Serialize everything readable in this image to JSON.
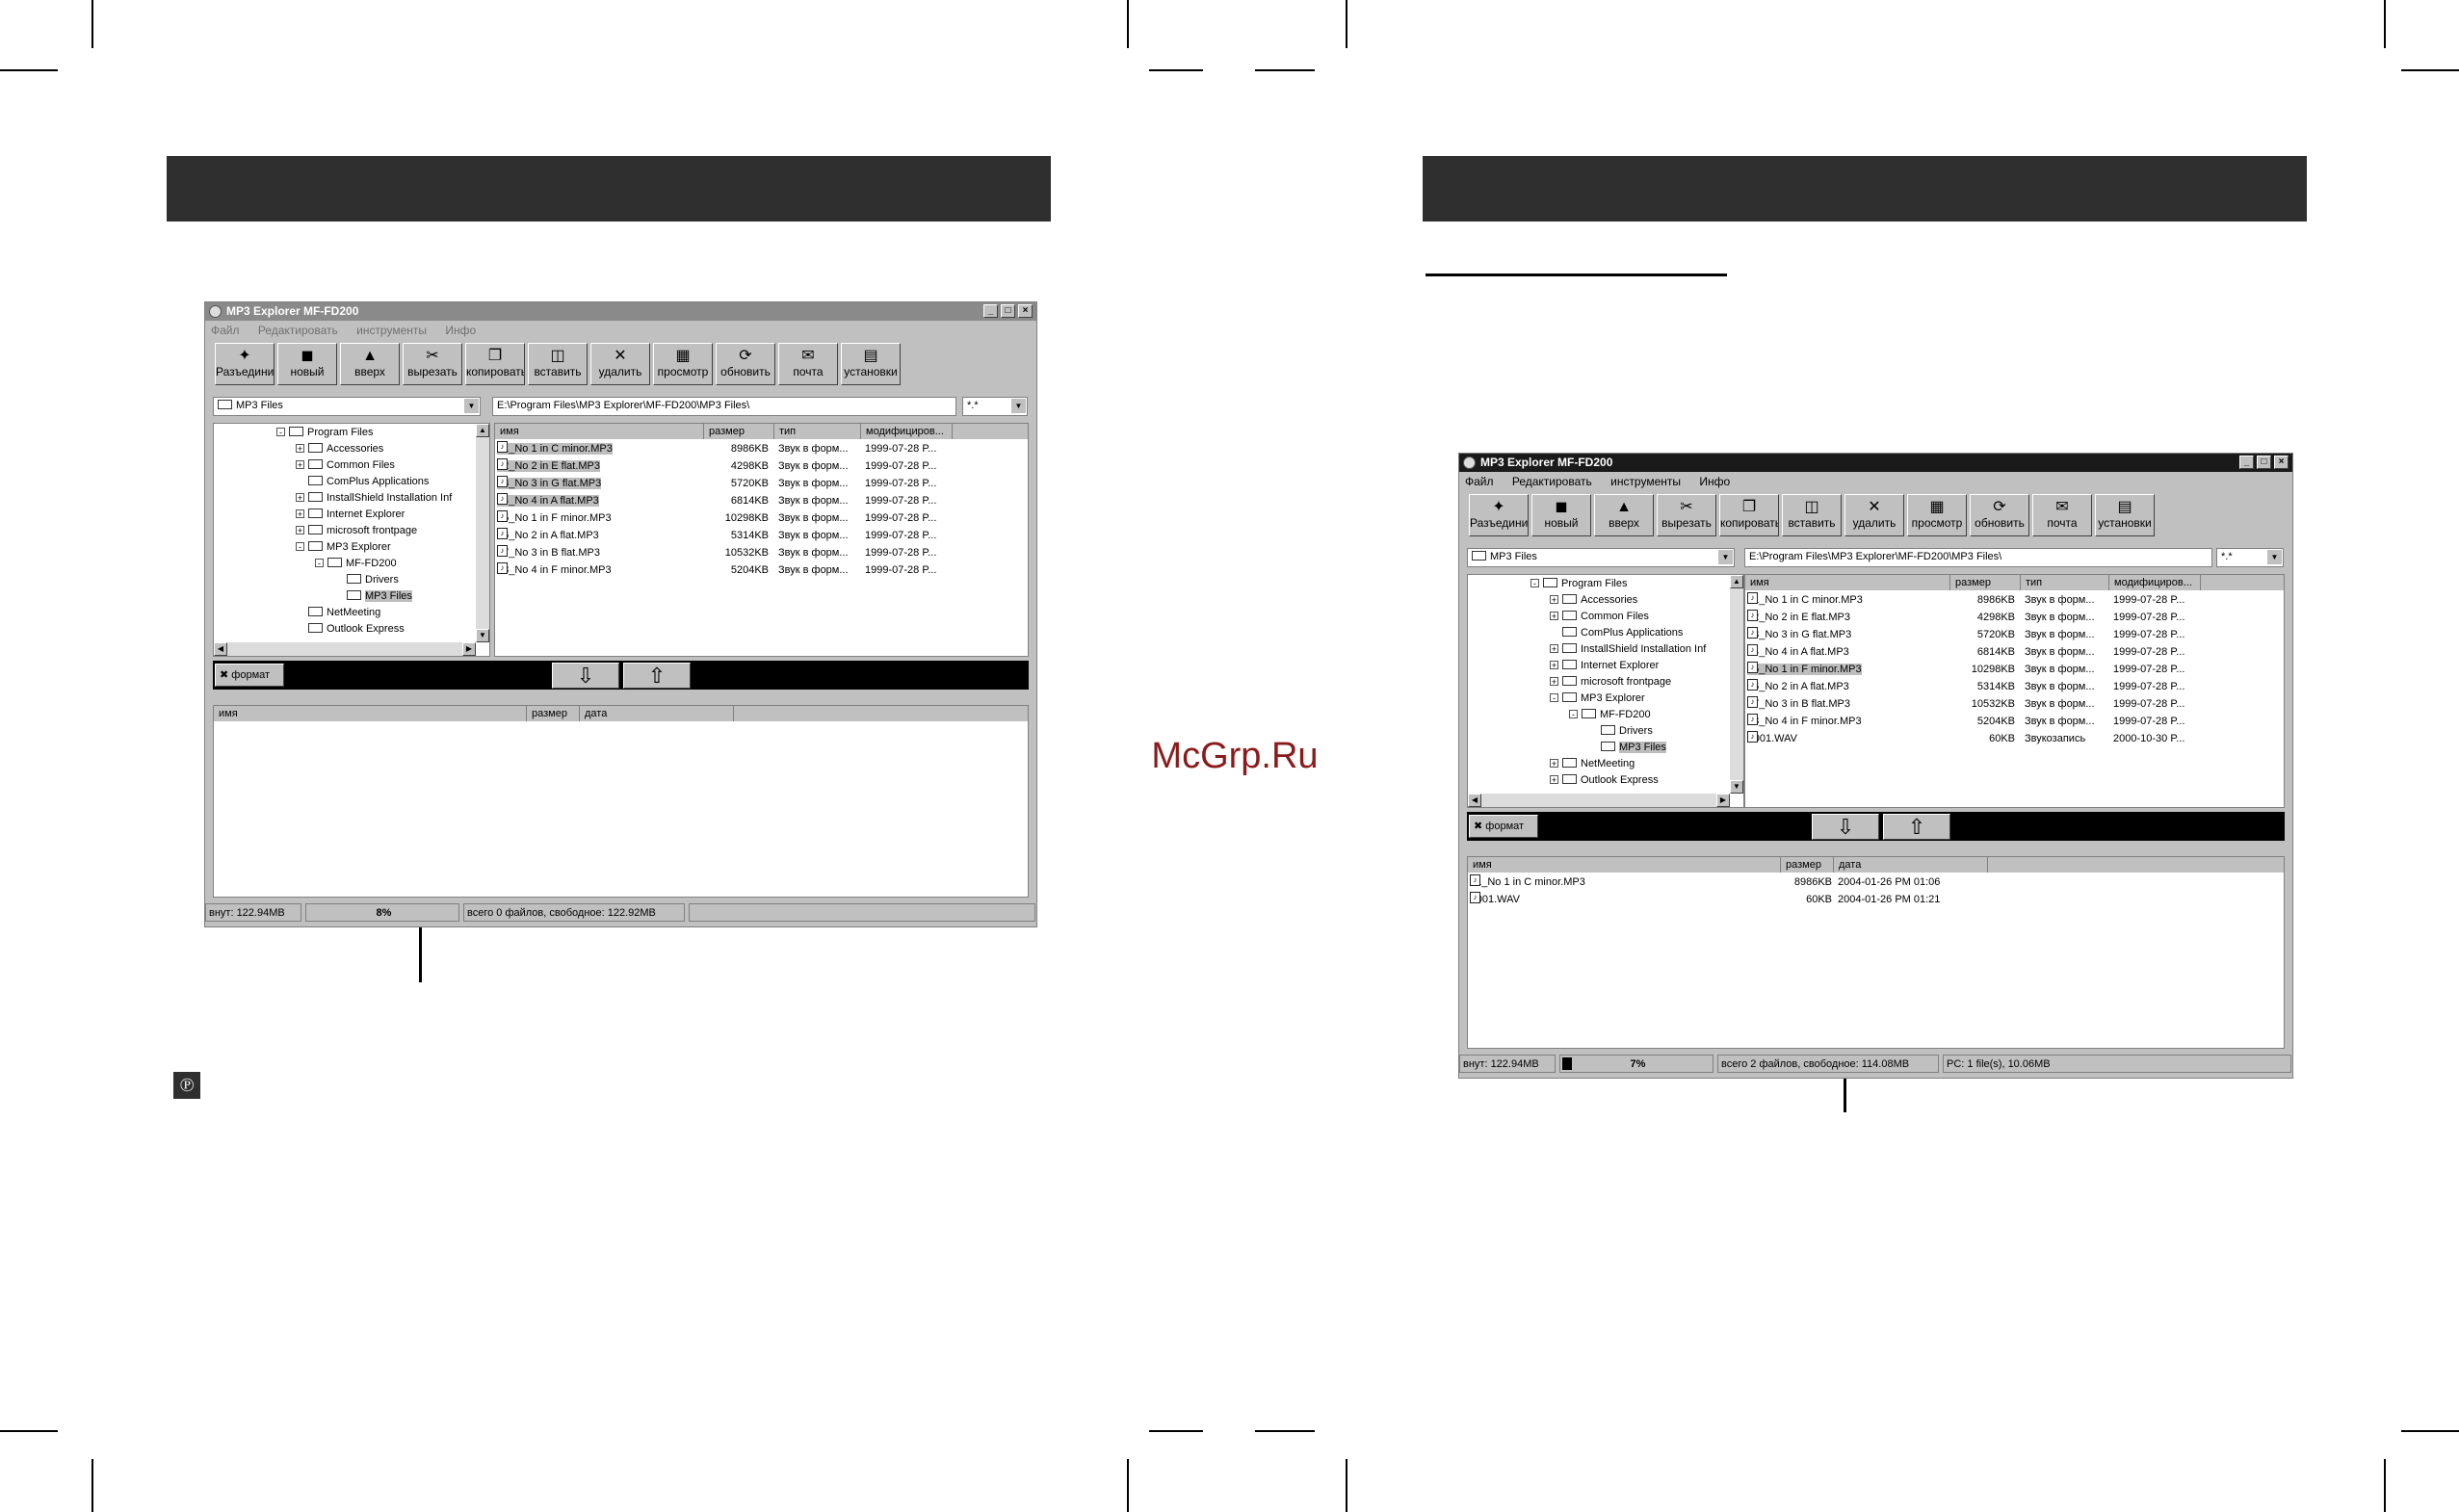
{
  "watermark": "McGrp.Ru",
  "left": {
    "window": {
      "title": "MP3 Explorer MF-FD200",
      "menu": [
        "Файл",
        "Редактировать",
        "инструменты",
        "Инфо"
      ],
      "toolbar": [
        "Разъединить",
        "новый",
        "вверх",
        "вырезать",
        "копировать",
        "вставить",
        "удалить",
        "просмотр",
        "обновить",
        "почта",
        "установки"
      ],
      "drive_combo": "MP3 Files",
      "path": "E:\\Program Files\\MP3 Explorer\\MF-FD200\\MP3 Files\\",
      "filter": "*.*",
      "tree": [
        "Program Files",
        "Accessories",
        "Common Files",
        "ComPlus Applications",
        "InstallShield Installation Inf",
        "Internet Explorer",
        "microsoft frontpage",
        "MP3 Explorer",
        "MF-FD200",
        "Drivers",
        "MP3 Files",
        "NetMeeting",
        "Outlook Express"
      ],
      "columns": [
        "имя",
        "размер",
        "тип",
        "модифициров..."
      ],
      "files": [
        {
          "name": "01_No 1 in C minor.MP3",
          "size": "8986KB",
          "type": "Звук в форм...",
          "date": "1999-07-28 P...",
          "selected": true
        },
        {
          "name": "02_No 2 in E flat.MP3",
          "size": "4298KB",
          "type": "Звук в форм...",
          "date": "1999-07-28 P...",
          "selected": true
        },
        {
          "name": "03_No 3 in G flat.MP3",
          "size": "5720KB",
          "type": "Звук в форм...",
          "date": "1999-07-28 P...",
          "selected": true
        },
        {
          "name": "04_No 4 in A flat.MP3",
          "size": "6814KB",
          "type": "Звук в форм...",
          "date": "1999-07-28 P...",
          "selected": true
        },
        {
          "name": "05_No 1 in F minor.MP3",
          "size": "10298KB",
          "type": "Звук в форм...",
          "date": "1999-07-28 P...",
          "selected": false
        },
        {
          "name": "06_No 2 in A flat.MP3",
          "size": "5314KB",
          "type": "Звук в форм...",
          "date": "1999-07-28 P...",
          "selected": false
        },
        {
          "name": "07_No 3 in B flat.MP3",
          "size": "10532KB",
          "type": "Звук в форм...",
          "date": "1999-07-28 P...",
          "selected": false
        },
        {
          "name": "08_No 4 in F minor.MP3",
          "size": "5204KB",
          "type": "Звук в форм...",
          "date": "1999-07-28 P...",
          "selected": false
        }
      ],
      "format_label": "формат",
      "device_columns": [
        "имя",
        "размер",
        "дата"
      ],
      "device_files": [],
      "status": {
        "internal": "внут: 122.94MB",
        "percent": "8%",
        "summary": "всего 0 файлов, свободное: 122.92MB",
        "pc": ""
      }
    }
  },
  "right": {
    "window": {
      "title": "MP3 Explorer MF-FD200",
      "menu": [
        "Файл",
        "Редактировать",
        "инструменты",
        "Инфо"
      ],
      "toolbar": [
        "Разъединить",
        "новый",
        "вверх",
        "вырезать",
        "копировать",
        "вставить",
        "удалить",
        "просмотр",
        "обновить",
        "почта",
        "установки"
      ],
      "drive_combo": "MP3 Files",
      "path": "E:\\Program Files\\MP3 Explorer\\MF-FD200\\MP3 Files\\",
      "filter": "*.*",
      "tree": [
        "Program Files",
        "Accessories",
        "Common Files",
        "ComPlus Applications",
        "InstallShield Installation Inf",
        "Internet Explorer",
        "microsoft frontpage",
        "MP3 Explorer",
        "MF-FD200",
        "Drivers",
        "MP3 Files",
        "NetMeeting",
        "Outlook Express"
      ],
      "columns": [
        "имя",
        "размер",
        "тип",
        "модифициров..."
      ],
      "files": [
        {
          "name": "01_No 1 in C minor.MP3",
          "size": "8986KB",
          "type": "Звук в форм...",
          "date": "1999-07-28 P...",
          "selected": false
        },
        {
          "name": "02_No 2 in E flat.MP3",
          "size": "4298KB",
          "type": "Звук в форм...",
          "date": "1999-07-28 P...",
          "selected": false
        },
        {
          "name": "03_No 3 in G flat.MP3",
          "size": "5720KB",
          "type": "Звук в форм...",
          "date": "1999-07-28 P...",
          "selected": false
        },
        {
          "name": "04_No 4 in A flat.MP3",
          "size": "6814KB",
          "type": "Звук в форм...",
          "date": "1999-07-28 P...",
          "selected": false
        },
        {
          "name": "05_No 1 in F minor.MP3",
          "size": "10298KB",
          "type": "Звук в форм...",
          "date": "1999-07-28 P...",
          "selected": true
        },
        {
          "name": "06_No 2 in A flat.MP3",
          "size": "5314KB",
          "type": "Звук в форм...",
          "date": "1999-07-28 P...",
          "selected": false
        },
        {
          "name": "07_No 3 in B flat.MP3",
          "size": "10532KB",
          "type": "Звук в форм...",
          "date": "1999-07-28 P...",
          "selected": false
        },
        {
          "name": "08_No 4 in F minor.MP3",
          "size": "5204KB",
          "type": "Звук в форм...",
          "date": "1999-07-28 P...",
          "selected": false
        },
        {
          "name": "F001.WAV",
          "size": "60KB",
          "type": "Звукозапись",
          "date": "2000-10-30 P...",
          "selected": false
        }
      ],
      "format_label": "формат",
      "device_columns": [
        "имя",
        "размер",
        "дата"
      ],
      "device_files": [
        {
          "name": "01_No 1 in C minor.MP3",
          "size": "8986KB",
          "date": "2004-01-26 PM 01:06"
        },
        {
          "name": "F001.WAV",
          "size": "60KB",
          "date": "2004-01-26 PM 01:21"
        }
      ],
      "status": {
        "internal": "внут: 122.94MB",
        "percent": "7%",
        "summary": "всего 2 файлов, свободное: 114.08MB",
        "pc": "PC: 1 file(s), 10.06MB"
      }
    }
  }
}
